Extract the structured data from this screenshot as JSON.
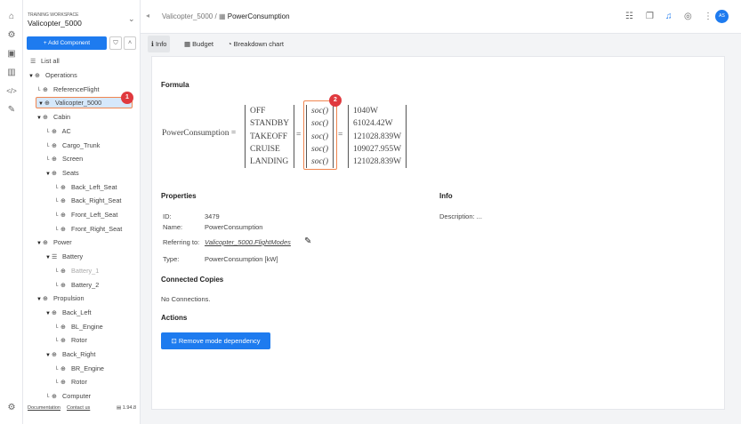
{
  "rail": {
    "icons": [
      "home-icon",
      "components-icon",
      "clipboard-icon",
      "chart-icon",
      "code-icon",
      "link-icon"
    ],
    "settings": "gear-icon"
  },
  "sidebar": {
    "workspace_label": "TRAINING WORKSPACE",
    "workspace_name": "Valicopter_5000",
    "add_component": "+ Add Component",
    "list_all": "List all",
    "tree": [
      {
        "label": "Operations",
        "level": 0,
        "toggle": "▼"
      },
      {
        "label": "ReferenceFlight",
        "level": 1
      },
      {
        "label": "Valicopter_5000",
        "level": 0,
        "toggle": "▼",
        "selected": true
      },
      {
        "label": "Cabin",
        "level": 1,
        "toggle": "▼"
      },
      {
        "label": "AC",
        "level": 2
      },
      {
        "label": "Cargo_Trunk",
        "level": 2
      },
      {
        "label": "Screen",
        "level": 2
      },
      {
        "label": "Seats",
        "level": 2,
        "toggle": "▼"
      },
      {
        "label": "Back_Left_Seat",
        "level": 3
      },
      {
        "label": "Back_Right_Seat",
        "level": 3
      },
      {
        "label": "Front_Left_Seat",
        "level": 3
      },
      {
        "label": "Front_Right_Seat",
        "level": 3
      },
      {
        "label": "Power",
        "level": 1,
        "toggle": "▼"
      },
      {
        "label": "Battery",
        "level": 2,
        "toggle": "▼"
      },
      {
        "label": "Battery_1",
        "level": 3,
        "dim": true
      },
      {
        "label": "Battery_2",
        "level": 3
      },
      {
        "label": "Propulsion",
        "level": 1,
        "toggle": "▼"
      },
      {
        "label": "Back_Left",
        "level": 2,
        "toggle": "▼"
      },
      {
        "label": "BL_Engine",
        "level": 3
      },
      {
        "label": "Rotor",
        "level": 3
      },
      {
        "label": "Back_Right",
        "level": 2,
        "toggle": "▼"
      },
      {
        "label": "BR_Engine",
        "level": 3
      },
      {
        "label": "Rotor",
        "level": 3
      },
      {
        "label": "Computer",
        "level": 2
      }
    ],
    "badge1": "1",
    "documentation": "Documentation",
    "contact": "Contact us",
    "version": "1.94.8"
  },
  "header": {
    "crumb_parent": "Valicopter_5000",
    "crumb_sep": "/",
    "crumb_current": "PowerConsumption",
    "avatar": "AS"
  },
  "tabs": [
    {
      "label": "Info"
    },
    {
      "label": "Budget"
    },
    {
      "label": "Breakdown chart"
    }
  ],
  "formula": {
    "heading": "Formula",
    "lhs": "PowerConsumption =",
    "modes": [
      "OFF",
      "STANDBY",
      "TAKEOFF",
      "CRUISE",
      "LANDING"
    ],
    "funcs": [
      "soc()",
      "soc()",
      "soc()",
      "soc()",
      "soc()"
    ],
    "values": [
      "1040W",
      "61024.42W",
      "121028.839W",
      "109027.955W",
      "121028.839W"
    ],
    "eq": "=",
    "badge2": "2"
  },
  "properties": {
    "heading": "Properties",
    "id_label": "ID:",
    "id": "3479",
    "name_label": "Name:",
    "name": "PowerConsumption",
    "ref_label": "Referring to:",
    "ref": "Valicopter_5000.FlightModes",
    "type_label": "Type:",
    "type": "PowerConsumption [kW]"
  },
  "info": {
    "heading": "Info",
    "description": "Description: ..."
  },
  "connected": {
    "heading": "Connected Copies",
    "text": "No Connections."
  },
  "actions": {
    "heading": "Actions",
    "remove": "Remove mode dependency"
  }
}
